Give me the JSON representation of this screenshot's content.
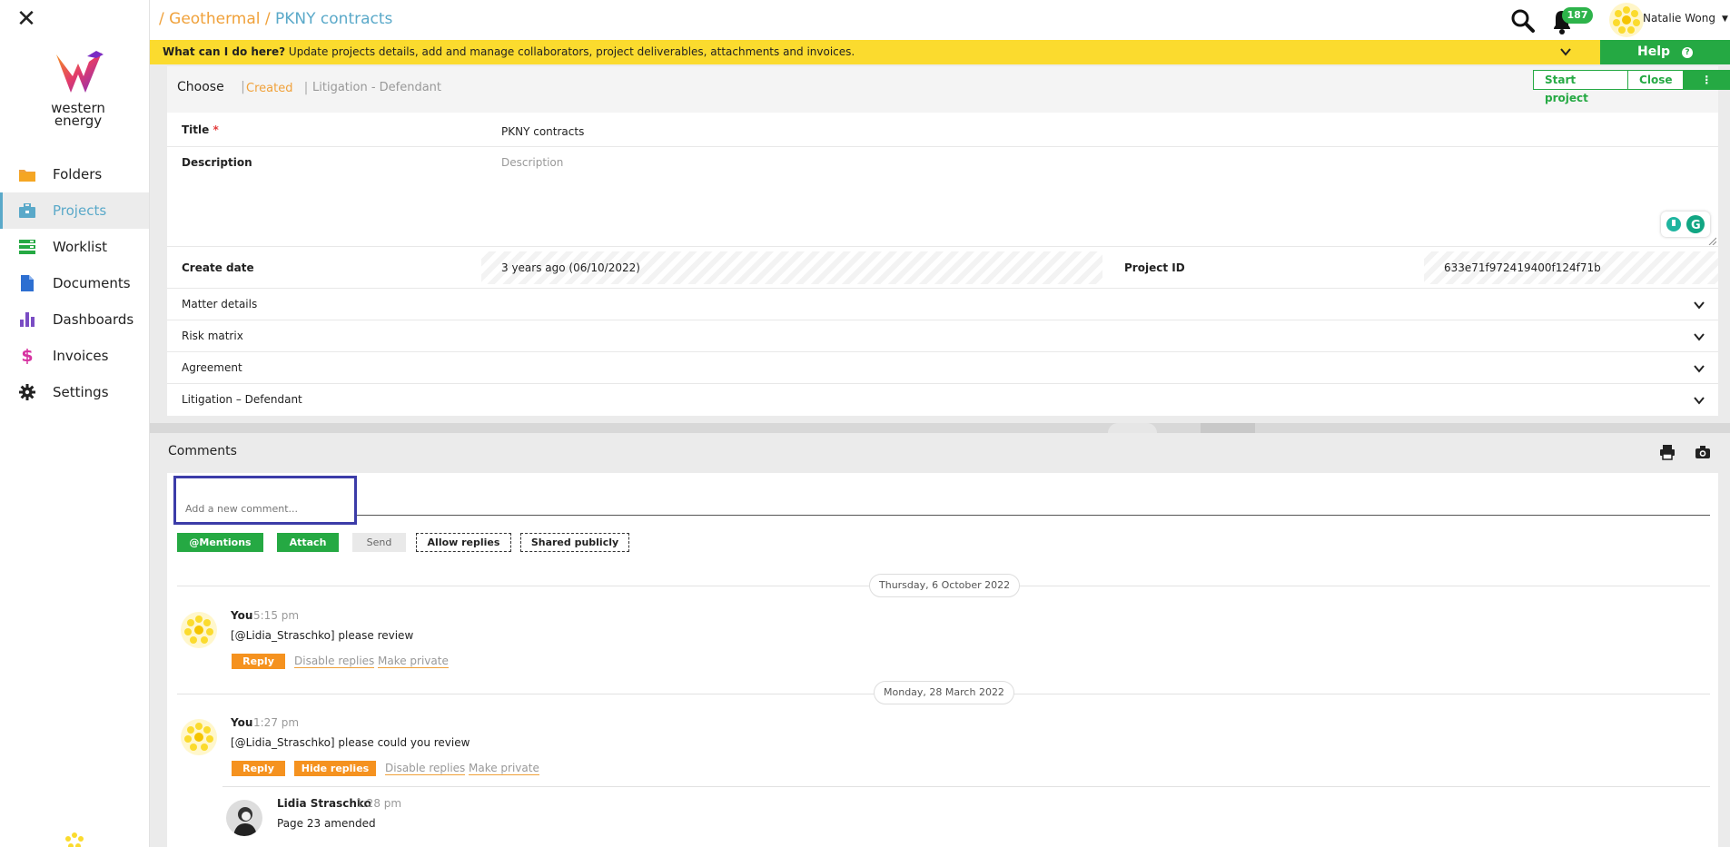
{
  "breadcrumb": {
    "sep": "/",
    "parent": "Geothermal",
    "current": "PKNY contracts"
  },
  "logo": {
    "line1": "western",
    "line2": "energy"
  },
  "sidebar": {
    "items": [
      {
        "label": "Folders",
        "icon": "folder-icon",
        "color": "#f0a13a"
      },
      {
        "label": "Projects",
        "icon": "briefcase-icon",
        "color": "#5aa9c9",
        "active": true
      },
      {
        "label": "Worklist",
        "icon": "worklist-icon",
        "color": "#25a943"
      },
      {
        "label": "Documents",
        "icon": "document-icon",
        "color": "#2d6fd1"
      },
      {
        "label": "Dashboards",
        "icon": "bar-chart-icon",
        "color": "#7a4cc4"
      },
      {
        "label": "Invoices",
        "icon": "dollar-icon",
        "color": "#d633a1"
      },
      {
        "label": "Settings",
        "icon": "gear-icon",
        "color": "#222222"
      }
    ]
  },
  "header": {
    "notifications": "187",
    "user_name": "Natalie Wong"
  },
  "helpbar": {
    "question": "What can I do here?",
    "text": "Update projects details, add and manage collaborators, project deliverables, attachments and invoices.",
    "help_label": "Help"
  },
  "status": {
    "choose": "Choose",
    "sep": "|",
    "created": "Created",
    "litigation": "Litigation - Defendant"
  },
  "actions": {
    "start": "Start project",
    "close": "Close",
    "more": "⋮"
  },
  "fields": {
    "title_label": "Title",
    "required_mark": "*",
    "title_value": "PKNY contracts",
    "description_label": "Description",
    "description_placeholder": "Description",
    "create_date_label": "Create date",
    "create_date_value": "3 years ago (06/10/2022)",
    "project_id_label": "Project ID",
    "project_id_value": "633e71f972419400f124f71b"
  },
  "accordions": [
    "Matter details",
    "Risk matrix",
    "Agreement",
    "Litigation – Defendant"
  ],
  "comments": {
    "title": "Comments",
    "input_placeholder": "Add a new comment...",
    "buttons": {
      "mentions": "@Mentions",
      "attach": "Attach",
      "send": "Send",
      "allow_replies": "Allow replies",
      "shared_publicly": "Shared publicly"
    },
    "days": [
      "Thursday, 6 October 2022",
      "Monday, 28 March 2022"
    ],
    "items": [
      {
        "author": "You",
        "time": "5:15 pm",
        "text": "[@Lidia_Straschko] please review",
        "reply": "Reply",
        "disable": "Disable replies",
        "private": "Make private"
      },
      {
        "author": "You",
        "time": "1:27 pm",
        "text": "[@Lidia_Straschko] please could you review",
        "reply": "Reply",
        "hide": "Hide replies",
        "disable": "Disable replies",
        "private": "Make private"
      }
    ],
    "reply": {
      "author": "Lidia Straschko",
      "time": "1:28 pm",
      "text": "Page 23 amended"
    }
  },
  "colors": {
    "accent_orange": "#f0a13a",
    "accent_blue": "#5aa9c9",
    "green": "#25a943",
    "yellow": "#fbdb2e"
  }
}
